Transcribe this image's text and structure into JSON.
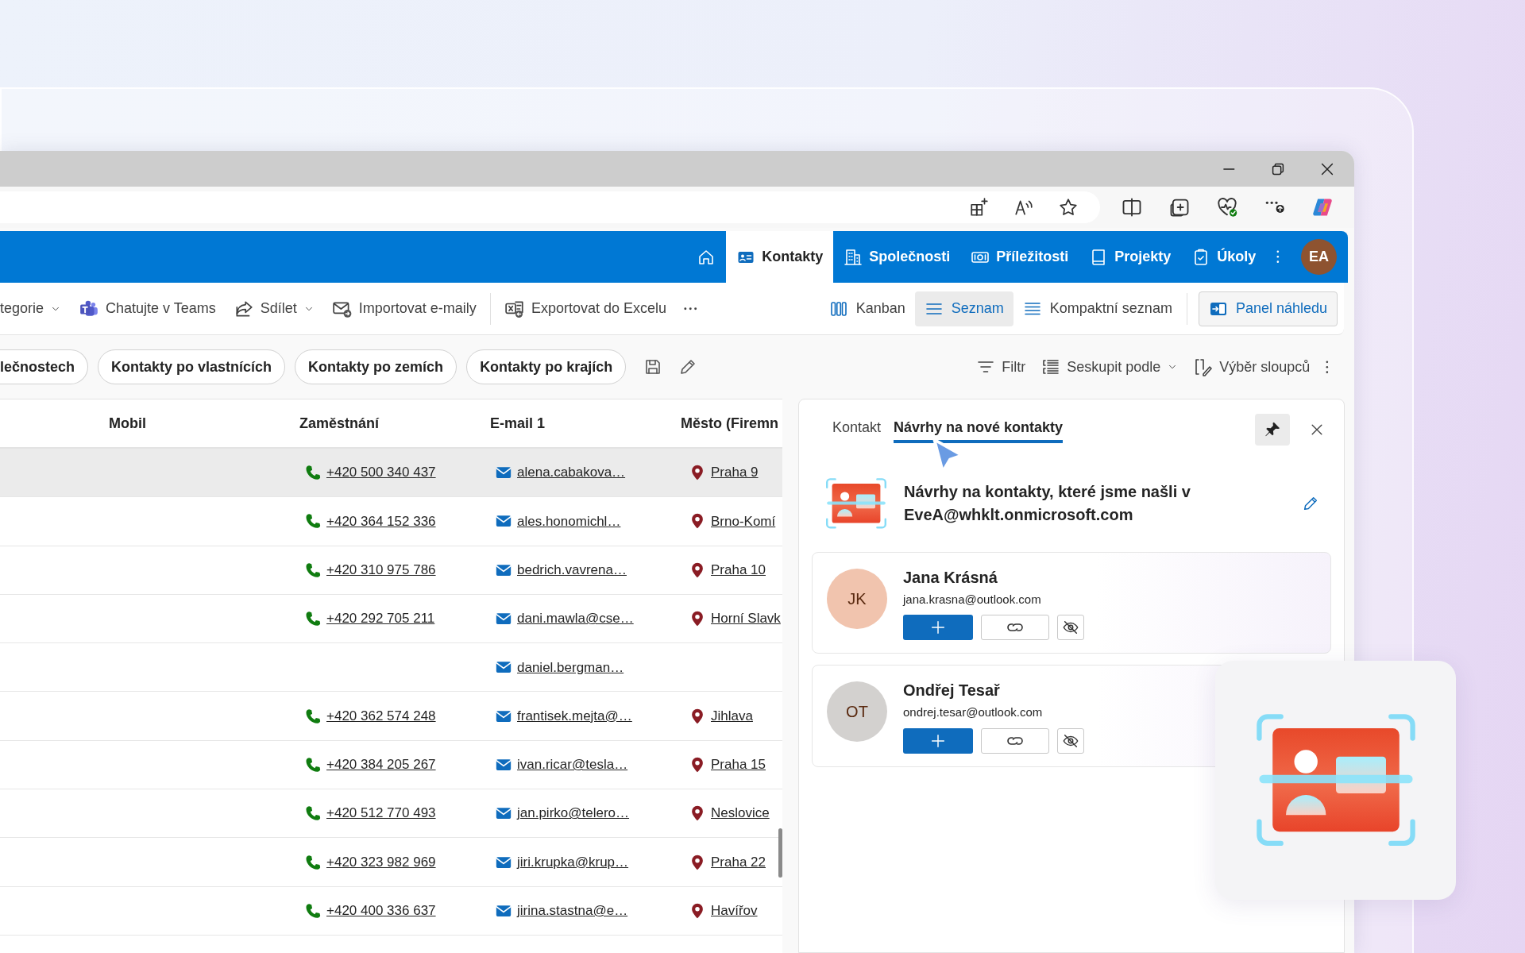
{
  "app_nav": {
    "items": [
      {
        "label": "Kontakty",
        "selected": true
      },
      {
        "label": "Společnosti",
        "selected": false
      },
      {
        "label": "Příležitosti",
        "selected": false
      },
      {
        "label": "Projekty",
        "selected": false
      },
      {
        "label": "Úkoly",
        "selected": false
      }
    ],
    "avatar": "EA"
  },
  "command_bar": {
    "items": [
      {
        "label": "tegorie",
        "dropdown": true
      },
      {
        "label": "Chatujte v Teams",
        "dropdown": false
      },
      {
        "label": "Sdílet",
        "dropdown": true
      },
      {
        "label": "Importovat e-maily",
        "dropdown": false
      },
      {
        "label": "Exportovat do Excelu",
        "dropdown": false
      }
    ],
    "views": [
      {
        "label": "Kanban",
        "selected": false
      },
      {
        "label": "Seznam",
        "selected": true
      },
      {
        "label": "Kompaktní seznam",
        "selected": false
      }
    ],
    "preview_button": "Panel náhledu"
  },
  "saved_views": [
    "lečnostech",
    "Kontakty po vlastnících",
    "Kontakty po zemích",
    "Kontakty po krajích"
  ],
  "list_tools": [
    {
      "label": "Filtr",
      "dropdown": false
    },
    {
      "label": "Seskupit podle",
      "dropdown": true
    },
    {
      "label": "Výběr sloupců",
      "dropdown": false
    }
  ],
  "table": {
    "columns": [
      "Mobil",
      "Zaměstnání",
      "E-mail 1",
      "Město (Firemn"
    ],
    "rows": [
      {
        "phone": "+420 500 340 437",
        "email": "alena.cabakova…",
        "city": "Praha 9",
        "selected": true
      },
      {
        "phone": "+420 364 152 336",
        "email": "ales.honomichl…",
        "city": "Brno-Komí",
        "selected": false
      },
      {
        "phone": "+420 310 975 786",
        "email": "bedrich.vavrena…",
        "city": "Praha 10",
        "selected": false
      },
      {
        "phone": "+420 292 705 211",
        "email": "dani.mawla@cse…",
        "city": "Horní Slavk",
        "selected": false
      },
      {
        "email": "daniel.bergman…",
        "selected": false
      },
      {
        "phone": "+420 362 574 248",
        "email": "frantisek.mejta@…",
        "city": "Jihlava",
        "selected": false
      },
      {
        "phone": "+420 384 205 267",
        "email": "ivan.ricar@tesla…",
        "city": "Praha 15",
        "selected": false
      },
      {
        "phone": "+420 512 770 493",
        "email": "jan.pirko@telero…",
        "city": "Neslovice",
        "selected": false
      },
      {
        "phone": "+420 323 982 969",
        "email": "jiri.krupka@krup…",
        "city": "Praha 22",
        "selected": false
      },
      {
        "phone": "+420 400 336 637",
        "email": "jirina.stastna@e…",
        "city": "Havířov",
        "selected": false
      }
    ]
  },
  "preview_panel": {
    "tabs": [
      {
        "label": "Kontakt",
        "selected": false
      },
      {
        "label": "Návrhy na nové kontakty",
        "selected": true
      }
    ],
    "heading": "Návrhy na kontakty, které jsme našli v EveA@whklt.onmicrosoft.com",
    "suggestions": [
      {
        "initials": "JK",
        "name": "Jana Krásná",
        "email": "jana.krasna@outlook.com",
        "color": "#f1c4ae"
      },
      {
        "initials": "OT",
        "name": "Ondřej Tesař",
        "email": "ondrej.tesar@outlook.com",
        "color": "#d3d1cf"
      }
    ]
  }
}
